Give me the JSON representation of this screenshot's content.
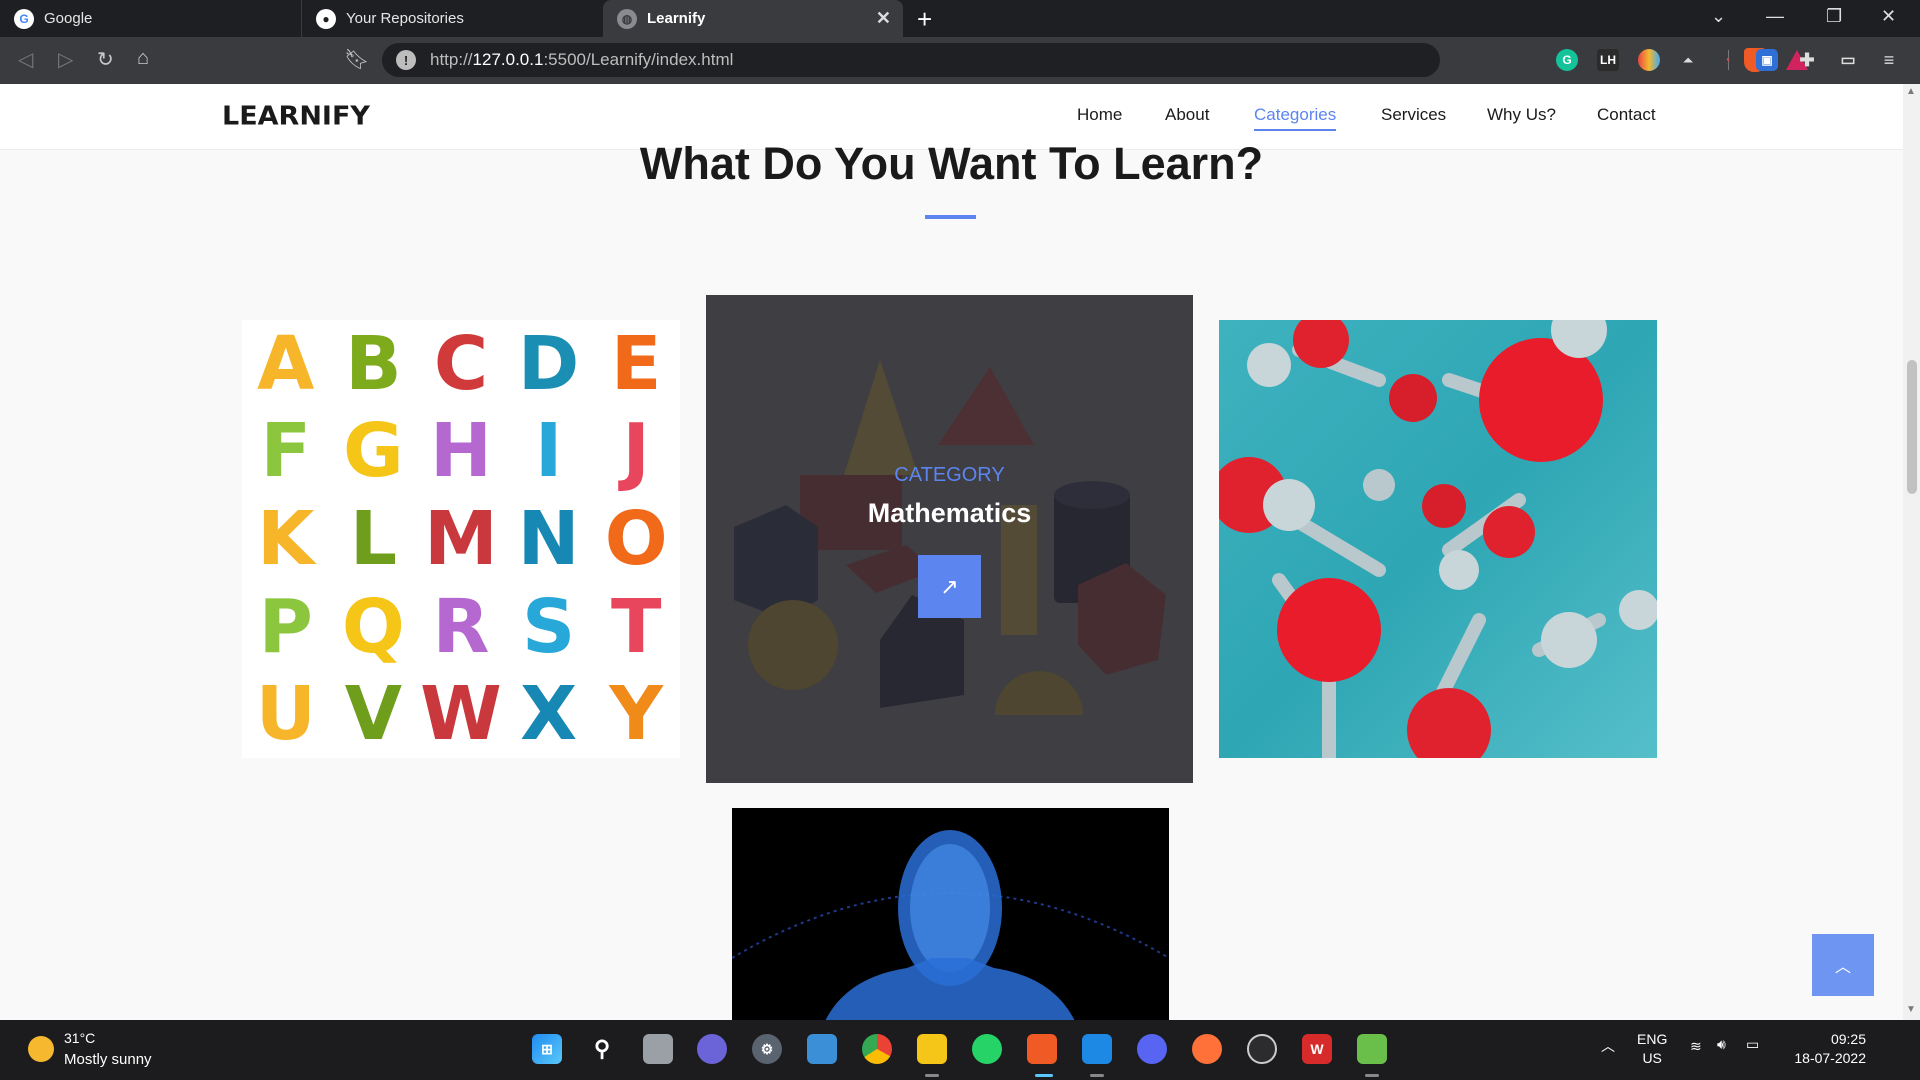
{
  "browser": {
    "tabs": [
      {
        "label": "Google",
        "icon": "google-icon"
      },
      {
        "label": "Your Repositories",
        "icon": "github-icon"
      },
      {
        "label": "Learnify",
        "icon": "globe-icon"
      }
    ],
    "url_prefix": "http://",
    "url_host": "127.0.0.1",
    "url_rest": ":5500/Learnify/index.html"
  },
  "site": {
    "logo": "LEARNIFY",
    "nav": [
      "Home",
      "About",
      "Categories",
      "Services",
      "Why Us?",
      "Contact"
    ],
    "active_nav": "Categories",
    "section_title": "What Do You Want To Learn?",
    "math_card": {
      "kicker": "CATEGORY",
      "name": "Mathematics"
    }
  },
  "alphabet": [
    "A",
    "B",
    "C",
    "D",
    "E",
    "F",
    "G",
    "H",
    "I",
    "J",
    "K",
    "L",
    "M",
    "N",
    "O",
    "P",
    "Q",
    "R",
    "S",
    "T",
    "U",
    "V",
    "W",
    "X",
    "Y"
  ],
  "alphabet_colors": [
    "#f7b52a",
    "#7dab1c",
    "#d13a3a",
    "#1b8fb3",
    "#f06a1a",
    "#8cc63f",
    "#f5c518",
    "#b569d0",
    "#27a8d8",
    "#e8465d",
    "#f7b52a",
    "#6f9e1d",
    "#c8383c",
    "#1788b3",
    "#f06a1a",
    "#8cc63f",
    "#f5c518",
    "#b569d0",
    "#27a8d8",
    "#e8465d",
    "#f7b52a",
    "#6f9e1d",
    "#c8383c",
    "#1788b3",
    "#f08b1a"
  ],
  "taskbar": {
    "weather_temp": "31°C",
    "weather_desc": "Mostly sunny",
    "lang_1": "ENG",
    "lang_2": "US",
    "time": "09:25",
    "date": "18-07-2022"
  },
  "colors": {
    "accent": "#5c85f0",
    "tab_bg": "#1e1f23",
    "toolbar_bg": "#3a3b3f"
  }
}
